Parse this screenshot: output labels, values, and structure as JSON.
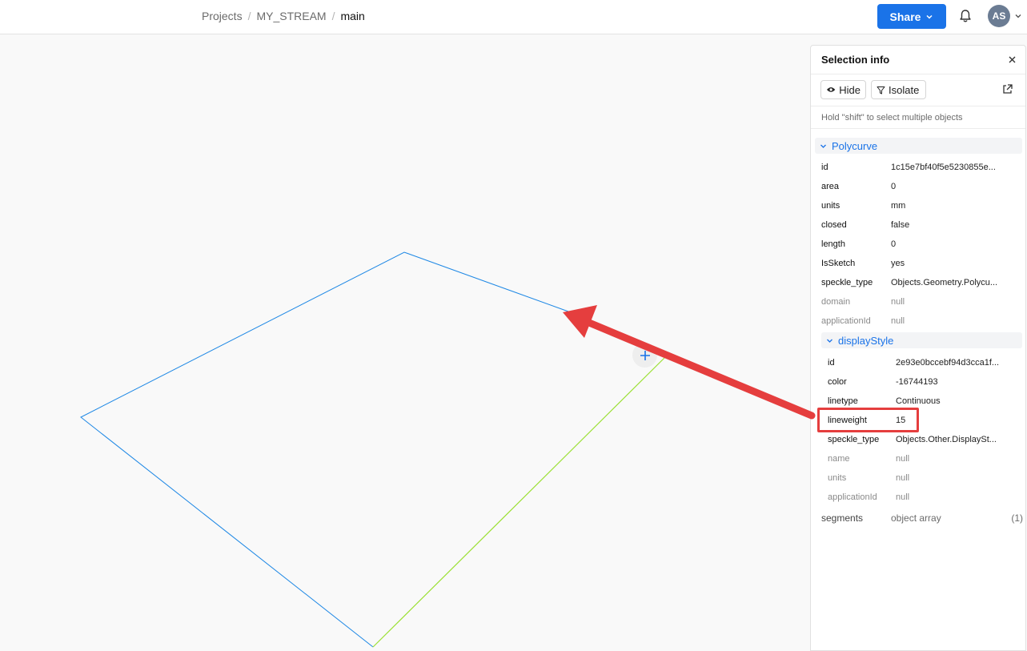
{
  "breadcrumb": {
    "projects": "Projects",
    "stream": "MY_STREAM",
    "branch": "main"
  },
  "header": {
    "share_label": "Share",
    "avatar_initials": "AS"
  },
  "panel": {
    "title": "Selection info",
    "hide_label": "Hide",
    "isolate_label": "Isolate",
    "hint": "Hold \"shift\" to select multiple objects",
    "group": "Polycurve",
    "rows": [
      {
        "key": "id",
        "value": "1c15e7bf40f5e5230855e..."
      },
      {
        "key": "area",
        "value": "0"
      },
      {
        "key": "units",
        "value": "mm"
      },
      {
        "key": "closed",
        "value": "false"
      },
      {
        "key": "length",
        "value": "0"
      },
      {
        "key": "IsSketch",
        "value": "yes"
      },
      {
        "key": "speckle_type",
        "value": "Objects.Geometry.Polycu..."
      },
      {
        "key": "domain",
        "value": "null"
      },
      {
        "key": "applicationId",
        "value": "null"
      }
    ],
    "subgroup": "displayStyle",
    "subrows": [
      {
        "key": "id",
        "value": "2e93e0bccebf94d3cca1f..."
      },
      {
        "key": "color",
        "value": "-16744193"
      },
      {
        "key": "linetype",
        "value": "Continuous"
      },
      {
        "key": "lineweight",
        "value": "15"
      },
      {
        "key": "speckle_type",
        "value": "Objects.Other.DisplaySt..."
      },
      {
        "key": "name",
        "value": "null"
      },
      {
        "key": "units",
        "value": "null"
      },
      {
        "key": "applicationId",
        "value": "null"
      }
    ],
    "segments": {
      "key": "segments",
      "value": "object array",
      "count": "(1)"
    }
  },
  "colors": {
    "accent": "#1a73e8",
    "curve_blue": "#1e88e5",
    "curve_green": "#9be034",
    "annotation_red": "#e53e3e"
  }
}
